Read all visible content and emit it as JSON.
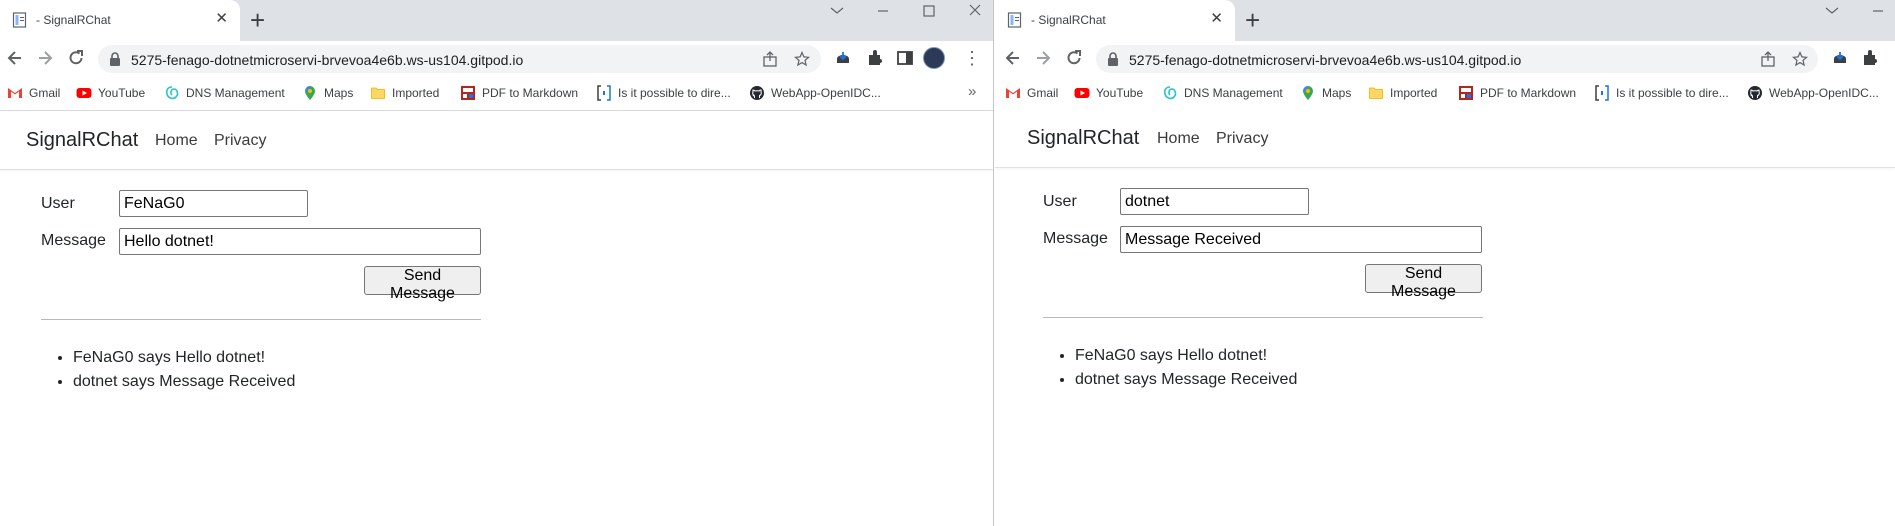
{
  "left": {
    "tab": {
      "title": "- SignalRChat"
    },
    "url": "5275-fenago-dotnetmicroservi-brvevoa4e6b.ws-us104.gitpod.io",
    "bookmarks": [
      "Gmail",
      "YouTube",
      "DNS Management",
      "Maps",
      "Imported",
      "PDF to Markdown",
      "Is it possible to dire...",
      "WebApp-OpenIDC..."
    ],
    "more_bookmarks": "»",
    "menu_glyph": "⋮",
    "brand": "SignalRChat",
    "nav": [
      "Home",
      "Privacy"
    ],
    "labels": {
      "user": "User",
      "message": "Message"
    },
    "inputs": {
      "user": "FeNaG0",
      "message": "Hello dotnet!"
    },
    "send_label": "Send Message",
    "messages": [
      "FeNaG0 says Hello dotnet!",
      "dotnet says Message Received"
    ]
  },
  "right": {
    "tab": {
      "title": "- SignalRChat"
    },
    "url": "5275-fenago-dotnetmicroservi-brvevoa4e6b.ws-us104.gitpod.io",
    "bookmarks": [
      "Gmail",
      "YouTube",
      "DNS Management",
      "Maps",
      "Imported",
      "PDF to Markdown",
      "Is it possible to dire...",
      "WebApp-OpenIDC..."
    ],
    "brand": "SignalRChat",
    "nav": [
      "Home",
      "Privacy"
    ],
    "labels": {
      "user": "User",
      "message": "Message"
    },
    "inputs": {
      "user": "dotnet",
      "message": "Message Received"
    },
    "send_label": "Send Message",
    "messages": [
      "FeNaG0 says Hello dotnet!",
      "dotnet says Message Received"
    ]
  },
  "icons": [
    "page-favicon",
    "close-icon",
    "plus-icon",
    "back-icon",
    "forward-icon",
    "reload-icon",
    "lock-icon",
    "share-icon",
    "star-icon",
    "download-icon",
    "extensions-icon",
    "sidepanel-icon",
    "avatar",
    "menu-icon"
  ],
  "colors": {
    "tabstrip": "#dee1e6",
    "omnibox": "#f1f3f4",
    "navbar_border": "#dee2e6",
    "button_bg": "#efefef"
  }
}
